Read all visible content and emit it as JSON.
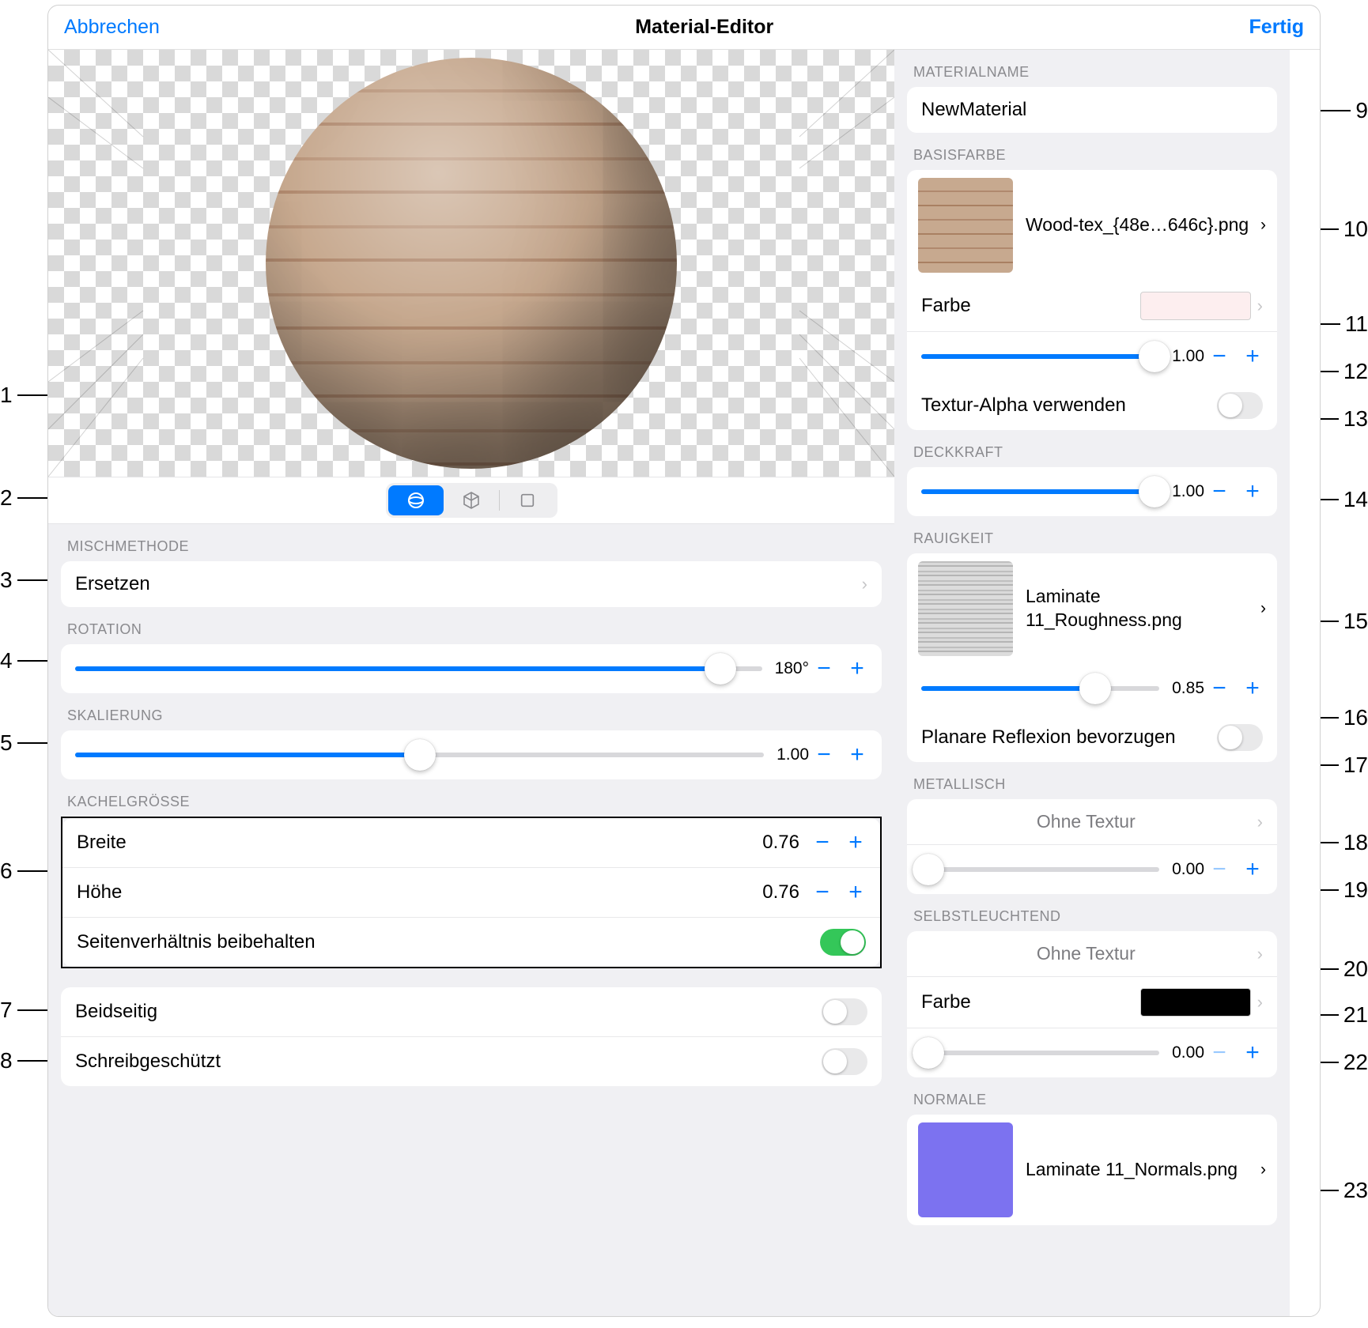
{
  "header": {
    "cancel": "Abbrechen",
    "title": "Material-Editor",
    "done": "Fertig"
  },
  "left": {
    "mixLabel": "MISCHMETHODE",
    "mixValue": "Ersetzen",
    "rotationLabel": "ROTATION",
    "rotationValue": "180°",
    "scaleLabel": "SKALIERUNG",
    "scaleValue": "1.00",
    "tileLabel": "KACHELGRÖSSE",
    "widthLabel": "Breite",
    "widthValue": "0.76",
    "heightLabel": "Höhe",
    "heightValue": "0.76",
    "aspectLabel": "Seitenverhältnis beibehalten",
    "doubleLabel": "Beidseitig",
    "readonlyLabel": "Schreibgeschützt"
  },
  "right": {
    "matNameLabel": "MATERIALNAME",
    "matName": "NewMaterial",
    "baseColorLabel": "BASISFARBE",
    "baseTex": "Wood-tex_{48e…646c}.png",
    "colorLabel": "Farbe",
    "baseColorSwatch": "#fdeeef",
    "baseSliderValue": "1.00",
    "texAlphaLabel": "Textur-Alpha verwenden",
    "opacityLabel": "DECKKRAFT",
    "opacityValue": "1.00",
    "roughLabel": "RAUIGKEIT",
    "roughTex": "Laminate 11_Roughness.png",
    "roughValue": "0.85",
    "planarLabel": "Planare Reflexion bevorzugen",
    "metalLabel": "METALLISCH",
    "noTex": "Ohne Textur",
    "metalValue": "0.00",
    "emissiveLabel": "SELBSTLEUCHTEND",
    "emissiveColor": "#000000",
    "emissiveValue": "0.00",
    "normalLabel": "NORMALE",
    "normalTex": "Laminate 11_Normals.png"
  },
  "callouts": {
    "c1": "1",
    "c2": "2",
    "c3": "3",
    "c4": "4",
    "c5": "5",
    "c6": "6",
    "c7": "7",
    "c8": "8",
    "c9": "9",
    "c10": "10",
    "c11": "11",
    "c12": "12",
    "c13": "13",
    "c14": "14",
    "c15": "15",
    "c16": "16",
    "c17": "17",
    "c18": "18",
    "c19": "19",
    "c20": "20",
    "c21": "21",
    "c22": "22",
    "c23": "23"
  }
}
